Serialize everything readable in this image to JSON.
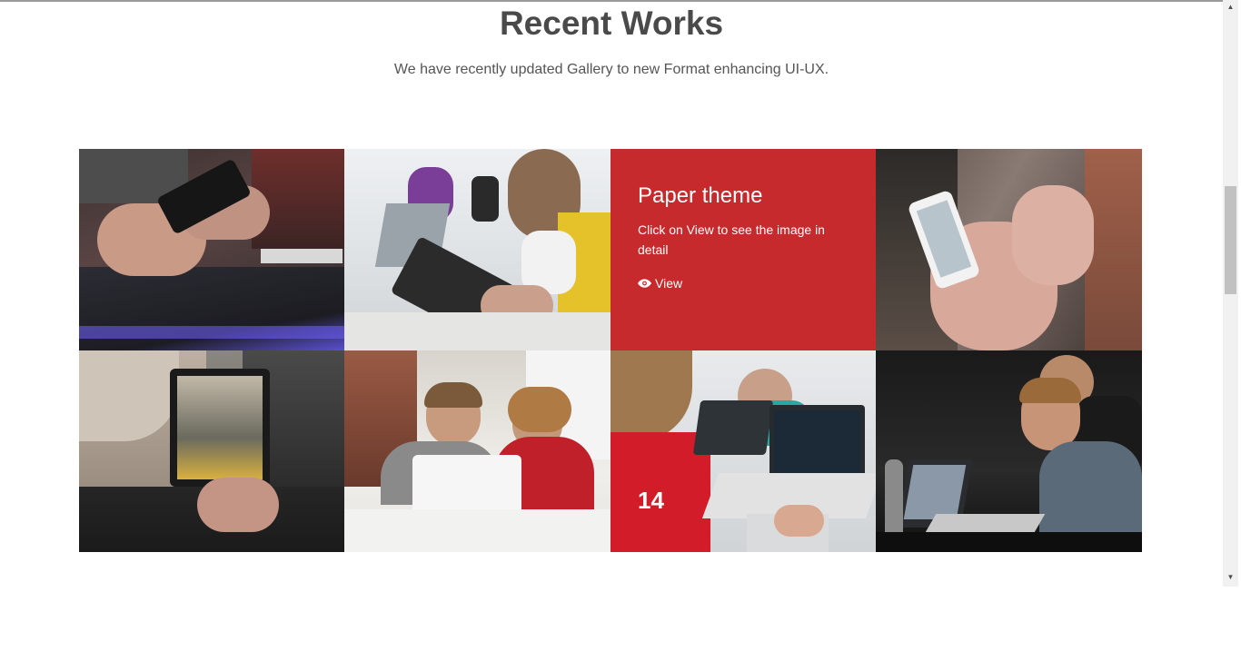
{
  "section": {
    "title": "Recent Works",
    "subtitle": "We have recently updated Gallery to new Format enhancing UI-UX."
  },
  "gallery": {
    "items": [
      {
        "name": "gallery-item-phone-laptop",
        "type": "photo",
        "description": "hands holding phone over laptop"
      },
      {
        "name": "gallery-item-tablet-drawing",
        "type": "photo",
        "description": "man drawing on tablet"
      },
      {
        "name": "gallery-item-paper-theme",
        "type": "card",
        "title": "Paper theme",
        "text": "Click on View to see the image in detail",
        "link_label": "View",
        "link_icon": "eye-icon"
      },
      {
        "name": "gallery-item-phone-hands",
        "type": "photo",
        "description": "hands holding smartphone"
      },
      {
        "name": "gallery-item-tablet-city",
        "type": "photo",
        "description": "woman holding tablet in city"
      },
      {
        "name": "gallery-item-kids-laptop",
        "type": "photo",
        "description": "two kids with laptop"
      },
      {
        "name": "gallery-item-boy-laptop",
        "type": "photo",
        "description": "boy coding on laptop"
      },
      {
        "name": "gallery-item-men-laptops",
        "type": "photo",
        "description": "men working on laptops"
      }
    ]
  },
  "colors": {
    "card_background": "#c62a2c",
    "title_text": "#4a4a4a",
    "subtitle_text": "#555555"
  }
}
